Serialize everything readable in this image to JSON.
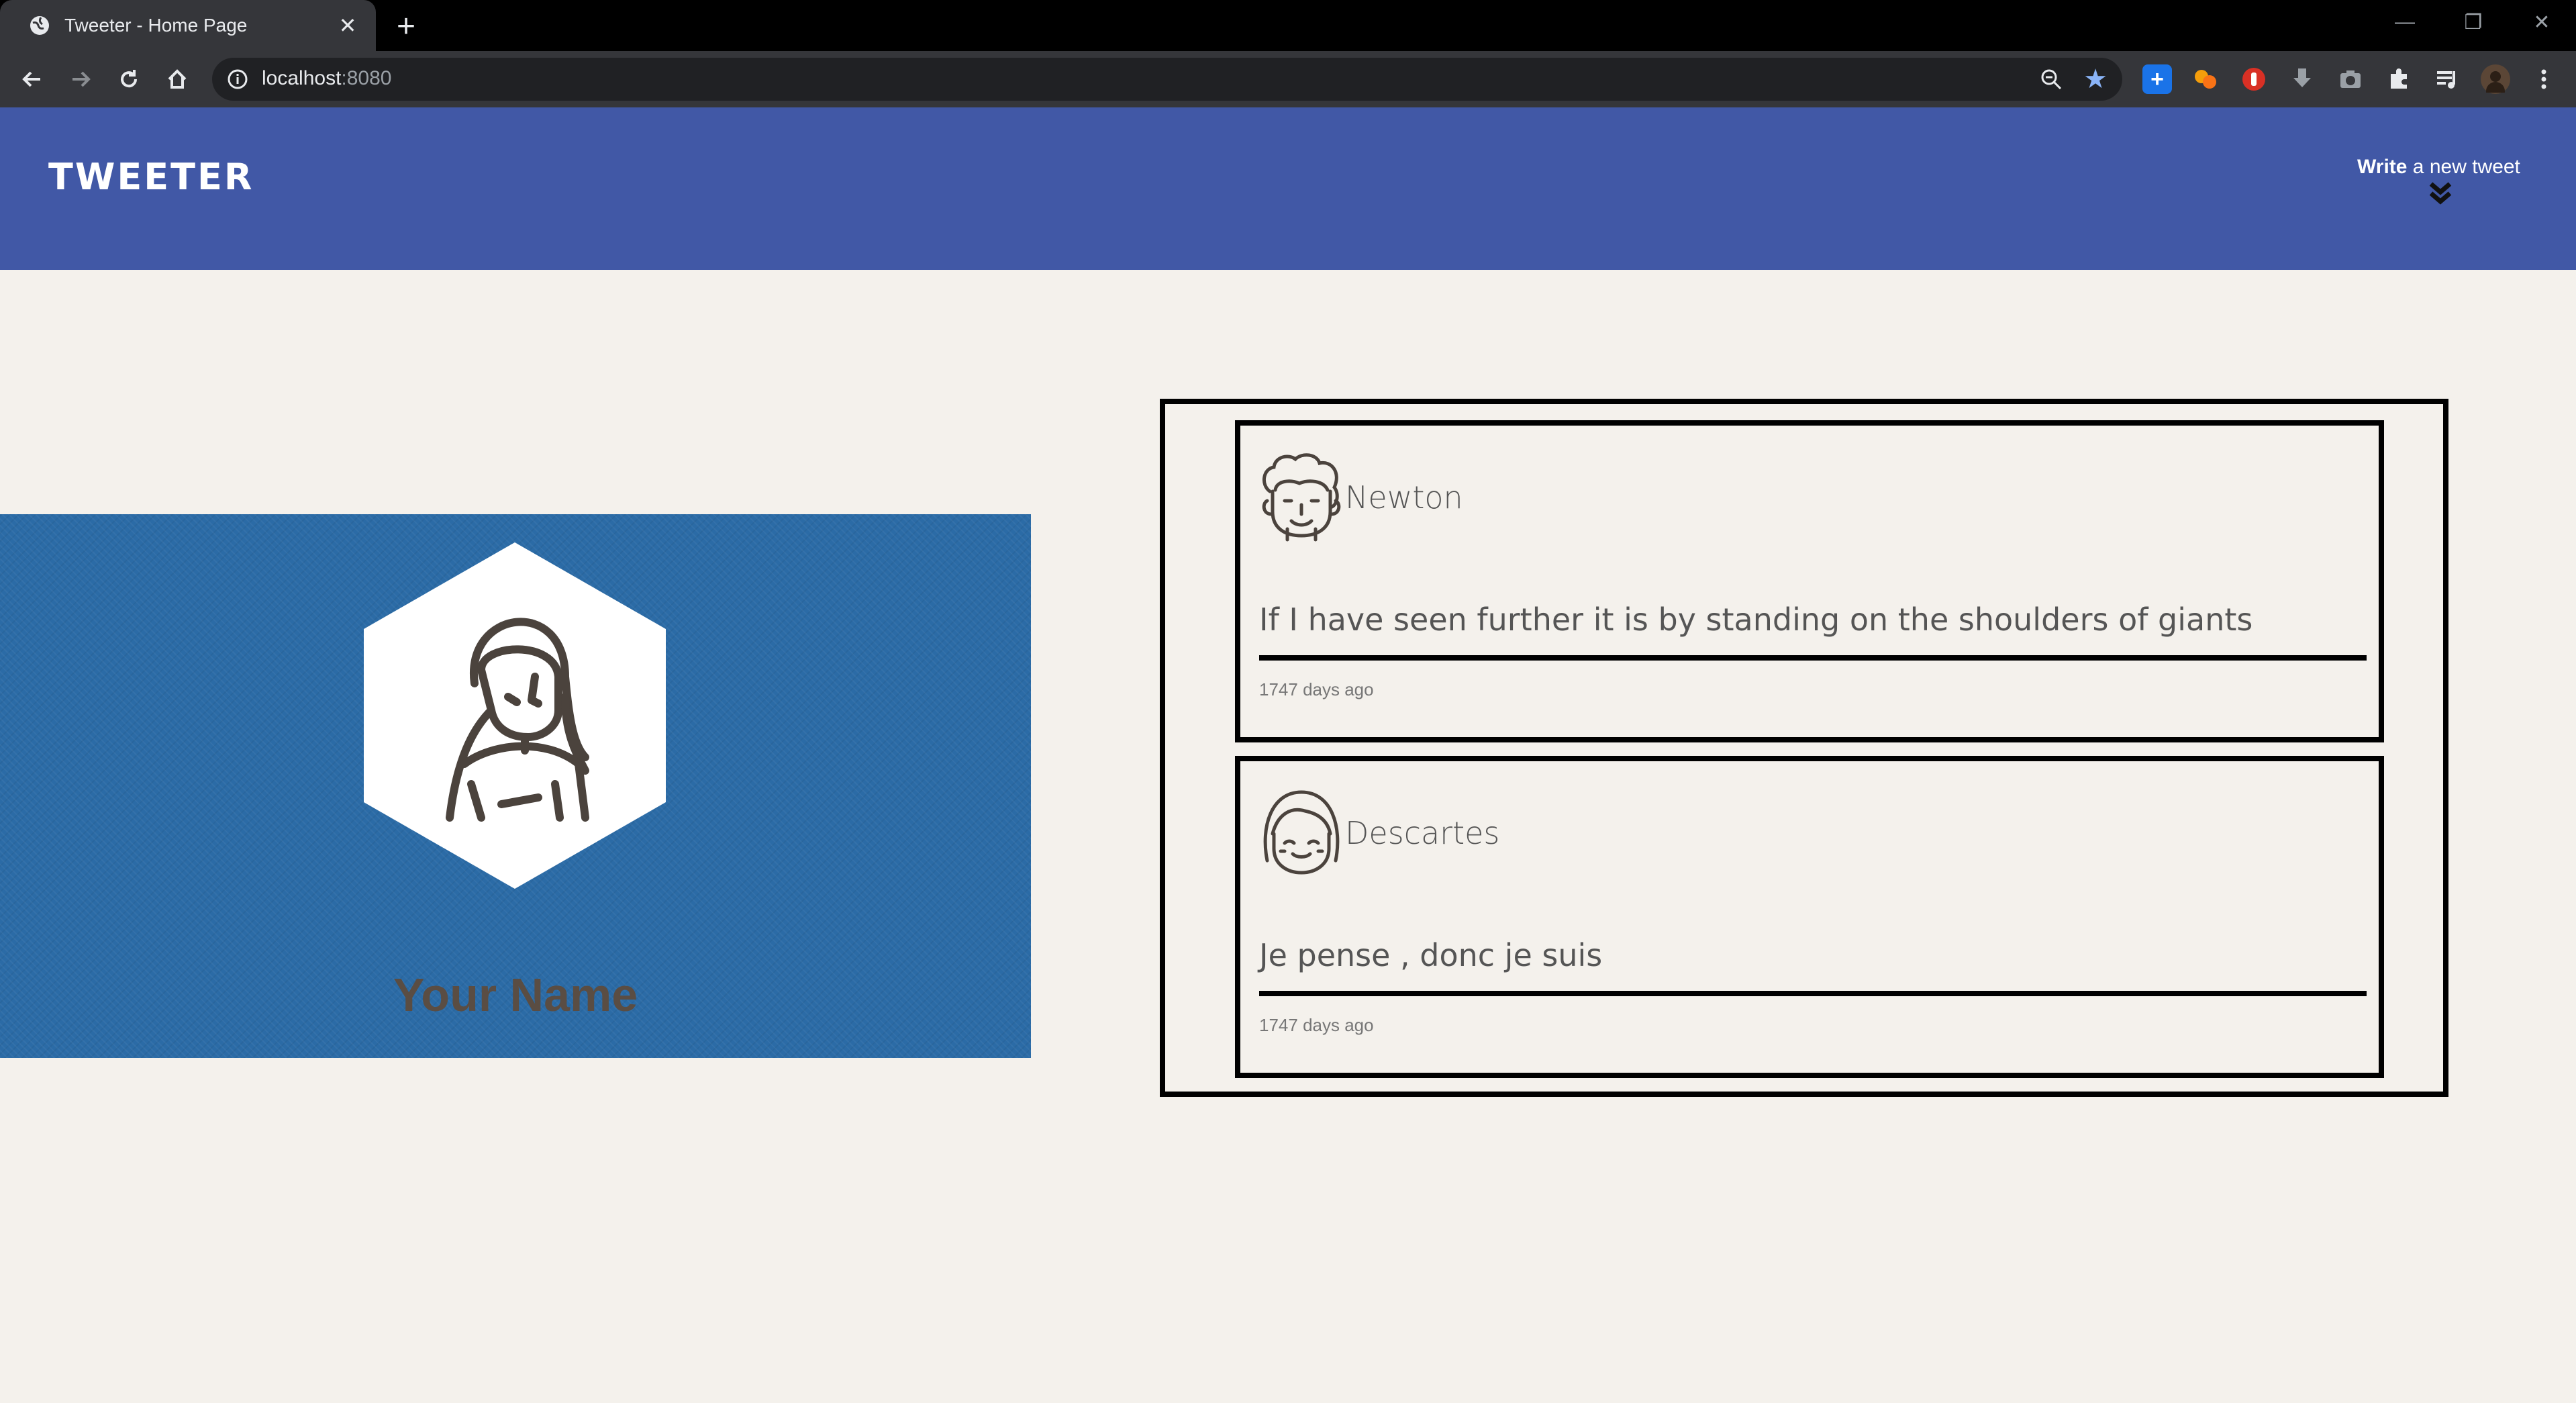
{
  "browser": {
    "tab_title": "Tweeter - Home Page",
    "url_host": "localhost",
    "url_port": ":8080"
  },
  "header": {
    "brand": "TWEETER",
    "compose_bold": "Write",
    "compose_rest": " a new tweet",
    "accent_color": "#4158a6"
  },
  "profile": {
    "name": "Your Name",
    "background_color": "#2b6ba6"
  },
  "tweets": [
    {
      "author": "Newton",
      "text": "If I have seen further it is by standing on the shoulders of giants",
      "time": "1747 days ago",
      "avatar_icon": "curly-hair-man-avatar-icon"
    },
    {
      "author": "Descartes",
      "text": "Je pense , donc je suis",
      "time": "1747 days ago",
      "avatar_icon": "bob-hair-woman-avatar-icon"
    }
  ]
}
